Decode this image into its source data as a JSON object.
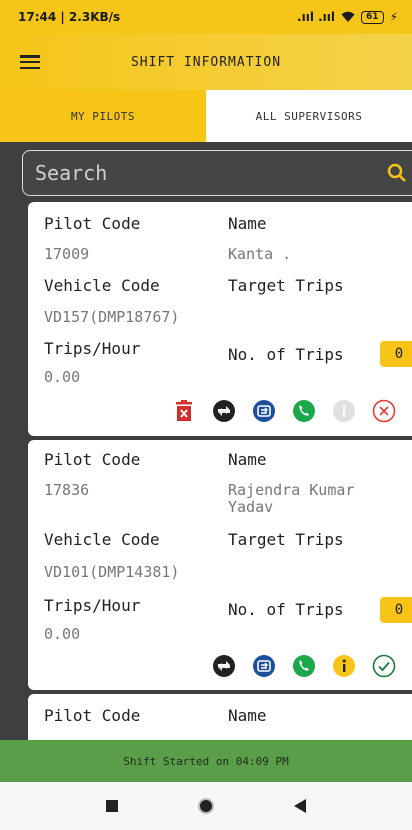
{
  "status_bar": {
    "time_speed": "17:44 | 2.3KB/s",
    "signal": ".ııl .ııl",
    "battery": "61"
  },
  "header": {
    "title": "SHIFT INFORMATION"
  },
  "tabs": [
    {
      "label": "MY PILOTS"
    },
    {
      "label": "ALL SUPERVISORS"
    }
  ],
  "search": {
    "placeholder": "Search"
  },
  "labels": {
    "pilot_code": "Pilot Code",
    "name": "Name",
    "vehicle_code": "Vehicle Code",
    "target_trips": "Target Trips",
    "trips_hour": "Trips/Hour",
    "no_of_trips": "No. of Trips"
  },
  "cards": [
    {
      "pilot_code": "17009",
      "name": "Kanta .",
      "vehicle_code": "VD157(DMP18767)",
      "trips_per_hour": "0.00",
      "no_of_trips": "0",
      "actions": [
        "delete-icon",
        "swap-icon",
        "switch-vehicle-icon",
        "phone-icon",
        "info-icon-disabled",
        "cancel-icon"
      ]
    },
    {
      "pilot_code": "17836",
      "name": "Rajendra Kumar Yadav",
      "vehicle_code": "VD101(DMP14381)",
      "trips_per_hour": "0.00",
      "no_of_trips": "0",
      "actions": [
        "swap-icon",
        "switch-vehicle-icon",
        "phone-icon",
        "info-icon",
        "check-icon"
      ]
    }
  ],
  "banner": {
    "text": "Shift Started on 04:09 PM"
  },
  "colors": {
    "accent": "#f6c518",
    "banner": "#5b9e4a",
    "delete": "#d32f2f",
    "blue": "#1e4f9c",
    "green": "#1aa84a",
    "cancel": "#e53935"
  }
}
